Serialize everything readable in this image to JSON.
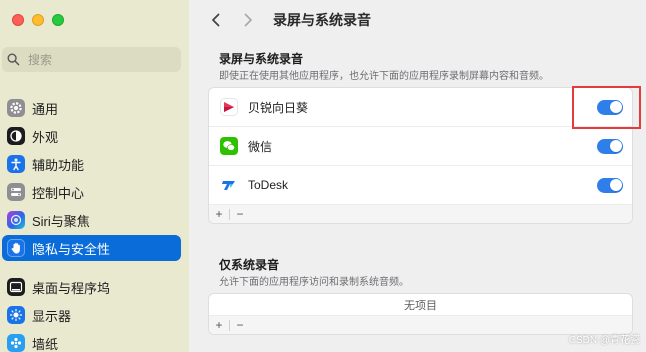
{
  "sidebar": {
    "search_placeholder": "搜索",
    "items": [
      {
        "label": "通用",
        "icon": "gear-icon"
      },
      {
        "label": "外观",
        "icon": "appearance-icon"
      },
      {
        "label": "辅助功能",
        "icon": "accessibility-icon"
      },
      {
        "label": "控制中心",
        "icon": "control-center-icon"
      },
      {
        "label": "Siri与聚焦",
        "icon": "siri-icon"
      },
      {
        "label": "隐私与安全性",
        "icon": "hand-icon",
        "active": true
      },
      {
        "label": "桌面与程序坞",
        "icon": "dock-icon"
      },
      {
        "label": "显示器",
        "icon": "display-icon"
      },
      {
        "label": "墙纸",
        "icon": "wallpaper-icon"
      }
    ]
  },
  "header": {
    "title": "录屏与系统录音"
  },
  "screen_section": {
    "heading": "录屏与系统录音",
    "description": "即使正在使用其他应用程序，也允许下面的应用程序录制屏幕内容和音频。",
    "apps": [
      {
        "name": "贝锐向日葵",
        "icon": "sunflower-icon",
        "enabled": true
      },
      {
        "name": "微信",
        "icon": "wechat-icon",
        "enabled": true
      },
      {
        "name": "ToDesk",
        "icon": "todesk-icon",
        "enabled": true
      }
    ],
    "add_label": "+",
    "remove_label": "−"
  },
  "audio_section": {
    "heading": "仅系统录音",
    "description": "允许下面的应用程序访问和录制系统音频。",
    "empty_label": "无项目",
    "add_label": "+",
    "remove_label": "−"
  },
  "watermark": "CSDN @青花瓷",
  "colors": {
    "accent": "#0a6cd9",
    "toggle_on": "#2e7fea",
    "highlight_box": "#e53b3b",
    "sidebar_bg": "#e9e9cf"
  }
}
